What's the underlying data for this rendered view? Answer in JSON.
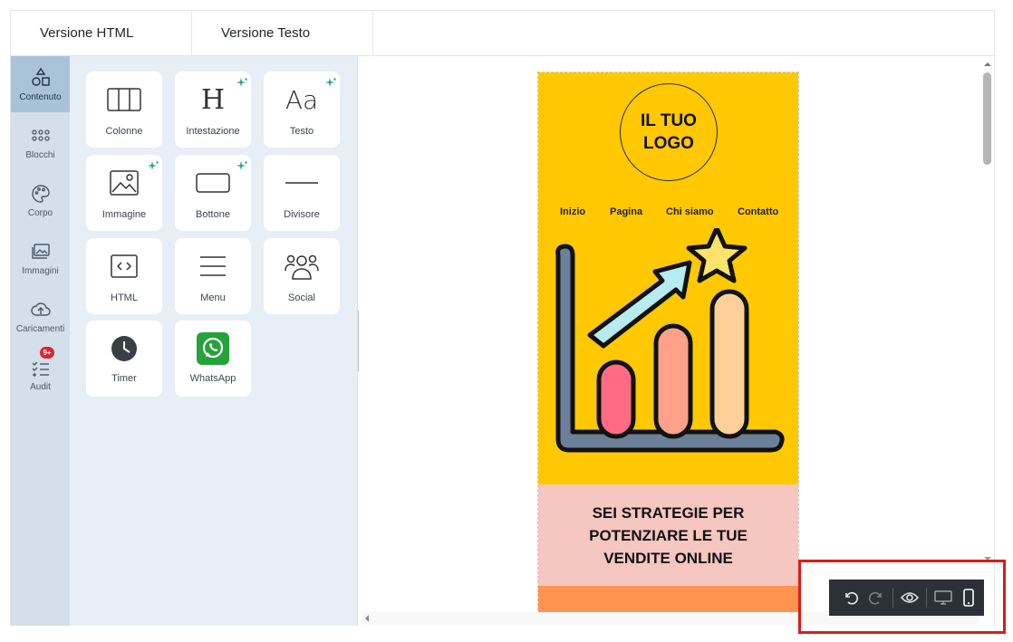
{
  "tabs": [
    {
      "label": "Versione HTML"
    },
    {
      "label": "Versione Testo"
    }
  ],
  "rail": [
    {
      "label": "Contenuto",
      "icon": "shapes-icon",
      "active": true
    },
    {
      "label": "Blocchi",
      "icon": "grid-dots-icon"
    },
    {
      "label": "Corpo",
      "icon": "palette-icon"
    },
    {
      "label": "Immagini",
      "icon": "images-icon"
    },
    {
      "label": "Caricamenti",
      "icon": "cloud-upload-icon"
    },
    {
      "label": "Audit",
      "icon": "checklist-icon",
      "badge": "9+"
    }
  ],
  "tiles": [
    {
      "label": "Colonne",
      "icon": "columns-icon",
      "ai": false
    },
    {
      "label": "Intestazione",
      "icon": "heading-icon",
      "ai": true
    },
    {
      "label": "Testo",
      "icon": "text-icon",
      "ai": true
    },
    {
      "label": "Immagine",
      "icon": "image-icon",
      "ai": true
    },
    {
      "label": "Bottone",
      "icon": "button-icon",
      "ai": true
    },
    {
      "label": "Divisore",
      "icon": "divider-icon",
      "ai": false
    },
    {
      "label": "HTML",
      "icon": "code-icon",
      "ai": false
    },
    {
      "label": "Menu",
      "icon": "menu-icon",
      "ai": false
    },
    {
      "label": "Social",
      "icon": "people-icon",
      "ai": false
    },
    {
      "label": "Timer",
      "icon": "clock-icon",
      "ai": false
    },
    {
      "label": "WhatsApp",
      "icon": "whatsapp-icon",
      "ai": false
    }
  ],
  "tile_glyphs": {
    "heading": "H",
    "text": "Aa"
  },
  "email": {
    "logo_text": "IL TUO\nLOGO",
    "nav": [
      "Inizio",
      "Pagina",
      "Chi siamo",
      "Contatto"
    ],
    "headline": "SEI STRATEGIE PER POTENZIARE LE TUE VENDITE ONLINE",
    "colors": {
      "hero": "#ffc800",
      "band": "#f6c6c0",
      "footer": "#ff9450"
    }
  },
  "toolbar": [
    {
      "name": "undo-button",
      "icon": "undo-icon"
    },
    {
      "name": "redo-button",
      "icon": "redo-icon"
    },
    {
      "name": "preview-button",
      "icon": "eye-icon"
    },
    {
      "name": "desktop-view-button",
      "icon": "monitor-icon"
    },
    {
      "name": "mobile-view-button",
      "icon": "smartphone-icon"
    }
  ],
  "accent": "#e01919"
}
